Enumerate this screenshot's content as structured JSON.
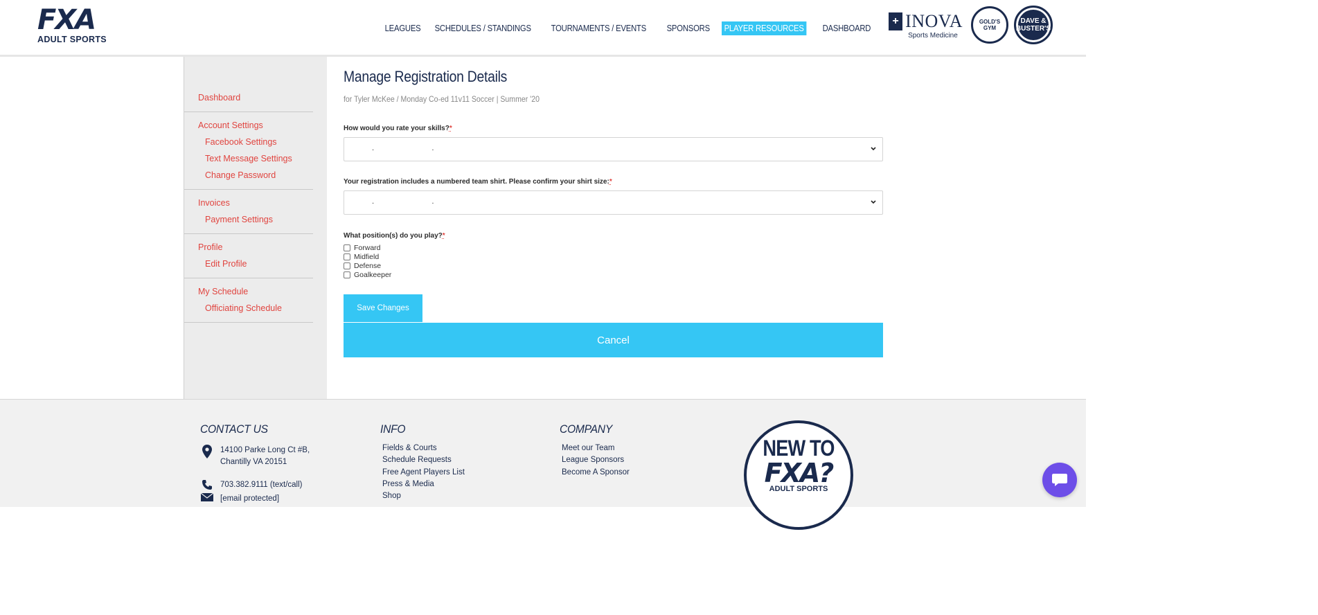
{
  "brand": {
    "fxa": "FXA",
    "adult_sports": "ADULT SPORTS"
  },
  "nav": {
    "items": [
      {
        "label": "LEAGUES"
      },
      {
        "label": "SCHEDULES / STANDINGS"
      },
      {
        "label": "TOURNAMENTS / EVENTS"
      },
      {
        "label": "SPONSORS"
      },
      {
        "label": "PLAYER RESOURCES",
        "active": true
      },
      {
        "label": "DASHBOARD"
      }
    ]
  },
  "sponsors": {
    "inova_name": "INOVA",
    "inova_sub": "Sports Medicine",
    "golds": "GOLD'S GYM",
    "dave": "DAVE & BUSTER'S"
  },
  "sidebar": {
    "groups": [
      {
        "items": [
          {
            "label": "Dashboard"
          }
        ]
      },
      {
        "items": [
          {
            "label": "Account Settings"
          },
          {
            "label": "Facebook Settings",
            "sub": true
          },
          {
            "label": "Text Message Settings",
            "sub": true
          },
          {
            "label": "Change Password",
            "sub": true
          }
        ]
      },
      {
        "items": [
          {
            "label": "Invoices"
          },
          {
            "label": "Payment Settings",
            "sub": true
          }
        ]
      },
      {
        "items": [
          {
            "label": "Profile"
          },
          {
            "label": "Edit Profile",
            "sub": true
          }
        ]
      },
      {
        "items": [
          {
            "label": "My Schedule"
          },
          {
            "label": "Officiating Schedule",
            "sub": true
          }
        ]
      }
    ]
  },
  "main": {
    "title": "Manage Registration Details",
    "subtitle": "for Tyler McKee / Monday Co-ed 11v11 Soccer | Summer '20",
    "q1": {
      "label": "How would you rate your skills?",
      "required": "*",
      "value": ". ."
    },
    "q2": {
      "label": "Your registration includes a numbered team shirt. Please confirm your shirt size:",
      "required": "*",
      "value": ". ."
    },
    "q3": {
      "label": "What position(s) do you play?",
      "required": "*",
      "options": [
        "Forward",
        "Midfield",
        "Defense",
        "Goalkeeper"
      ]
    },
    "save_label": "Save Changes",
    "cancel_label": "Cancel"
  },
  "footer": {
    "contact": {
      "heading": "CONTACT US",
      "address_line1": "14100 Parke Long Ct #B,",
      "address_line2": "Chantilly VA 20151",
      "phone": "703.382.9111 (text/call)",
      "email": "[email protected]"
    },
    "info": {
      "heading": "INFO",
      "links": [
        "Fields & Courts",
        "Schedule Requests",
        "Free Agent Players List",
        "Press & Media",
        "Shop"
      ]
    },
    "company": {
      "heading": "COMPANY",
      "links": [
        "Meet our Team",
        "League Sponsors",
        "Become A Sponsor"
      ]
    },
    "badge": {
      "line1": "NEW TO",
      "line2": "FXA?",
      "line3": "ADULT SPORTS"
    }
  },
  "colors": {
    "accent": "#35c6f4",
    "navy": "#1a2a4d",
    "link_red": "#e0443f",
    "chat": "#6d4ee8"
  }
}
